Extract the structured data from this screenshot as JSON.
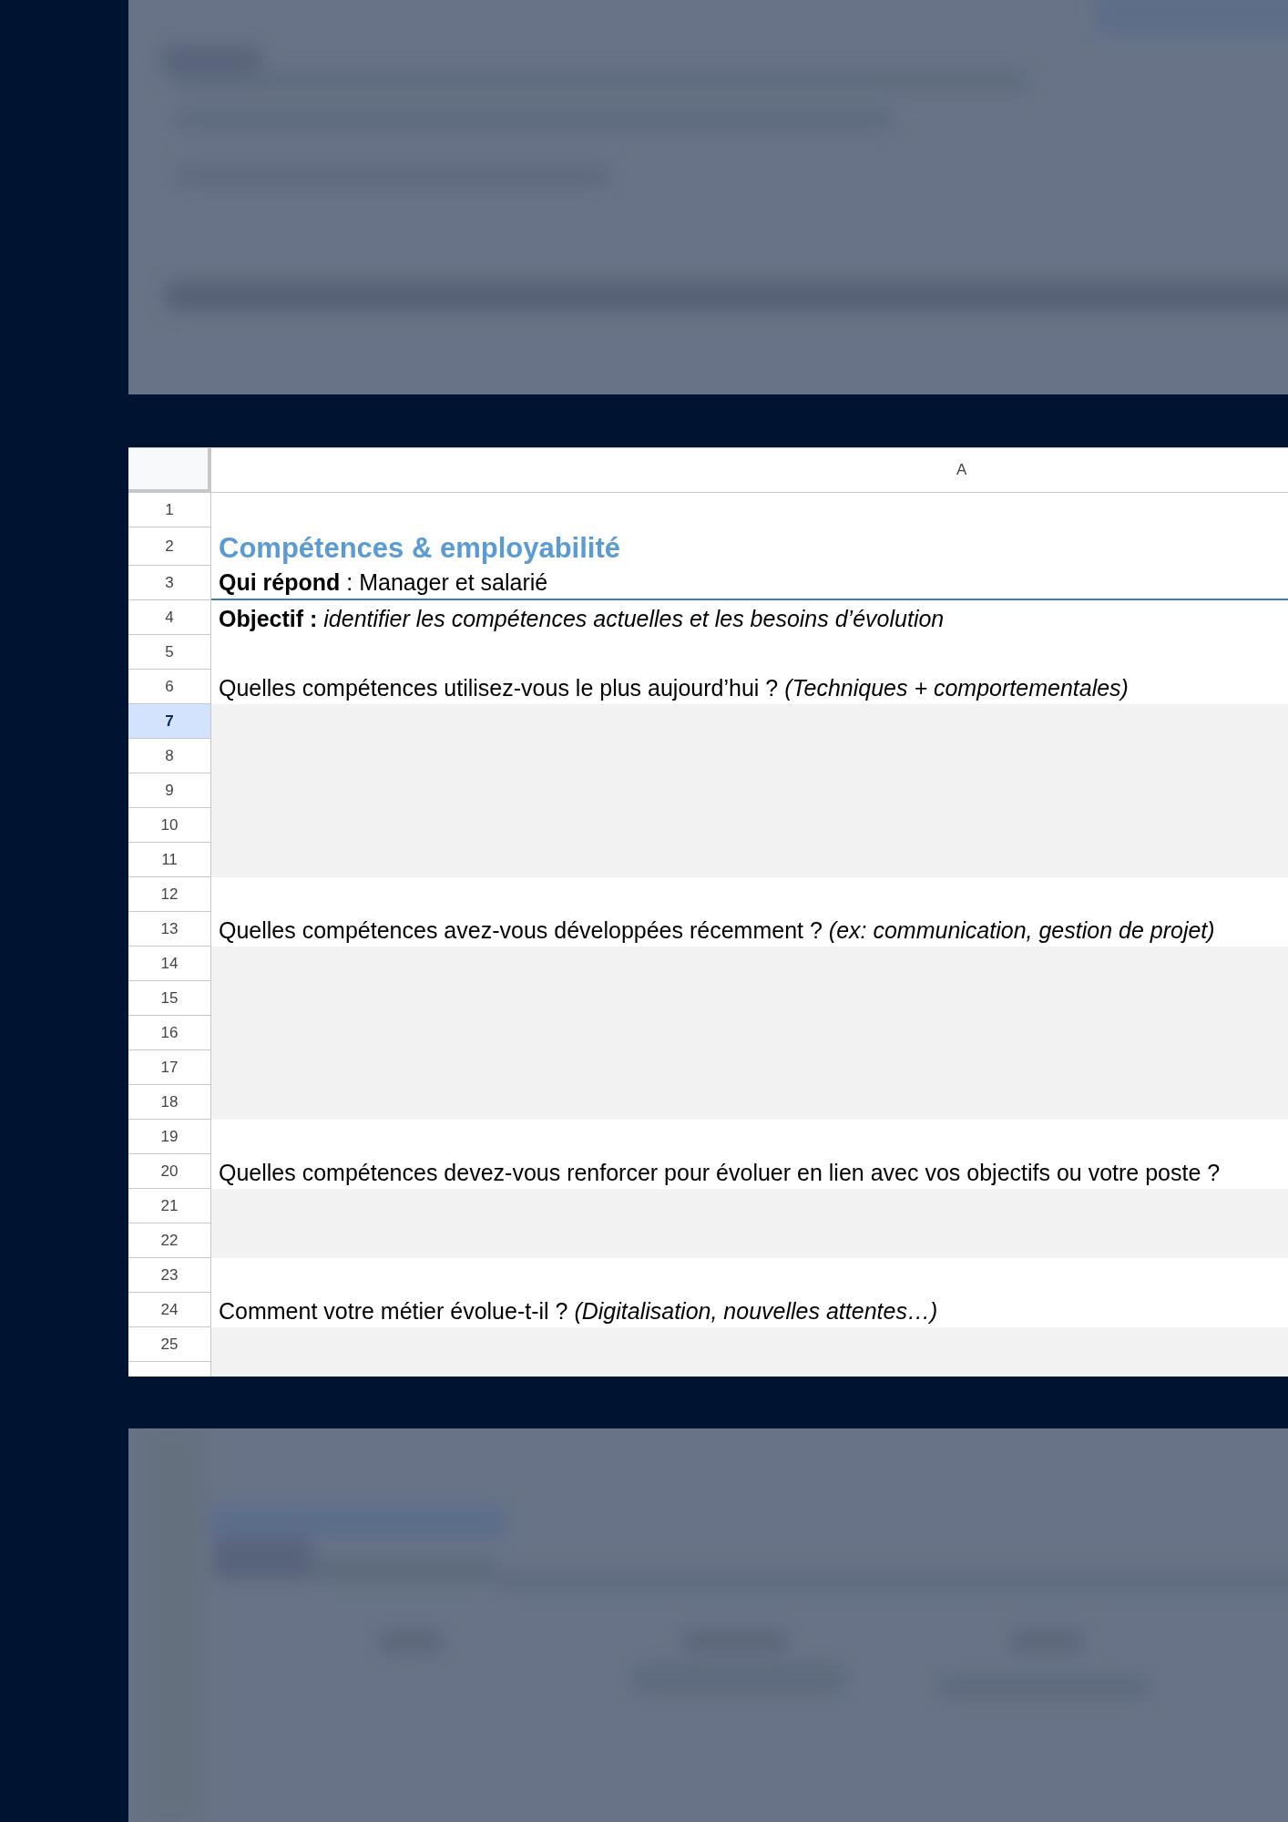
{
  "sheet": {
    "columns": [
      {
        "label": "A"
      }
    ],
    "rows": [
      {
        "number": "1",
        "kind": "blank",
        "selected": false,
        "bottom_border": false
      },
      {
        "number": "2",
        "kind": "title",
        "text": "Compétences & employabilité",
        "selected": false,
        "bottom_border": false
      },
      {
        "number": "3",
        "kind": "info",
        "text": "**Qui répond** : Manager et salarié",
        "selected": false,
        "bottom_border": true
      },
      {
        "number": "4",
        "kind": "info",
        "text": "**Objectif :** *identifier les compétences actuelles et les besoins d’évolution*",
        "selected": false,
        "bottom_border": false
      },
      {
        "number": "5",
        "kind": "blank",
        "selected": false,
        "bottom_border": false
      },
      {
        "number": "6",
        "kind": "question",
        "text": "Quelles compétences utilisez-vous le plus aujourd’hui ? *(Techniques + comportementales)*",
        "selected": false,
        "bottom_border": false
      },
      {
        "number": "7",
        "kind": "answer",
        "selected": true,
        "bottom_border": false
      },
      {
        "number": "8",
        "kind": "answer",
        "selected": false,
        "bottom_border": false
      },
      {
        "number": "9",
        "kind": "answer",
        "selected": false,
        "bottom_border": false
      },
      {
        "number": "10",
        "kind": "answer",
        "selected": false,
        "bottom_border": false
      },
      {
        "number": "11",
        "kind": "answer",
        "selected": false,
        "bottom_border": false
      },
      {
        "number": "12",
        "kind": "blank",
        "selected": false,
        "bottom_border": false
      },
      {
        "number": "13",
        "kind": "question",
        "text": "Quelles compétences avez-vous développées récemment ? *(ex: communication, gestion de projet)*",
        "selected": false,
        "bottom_border": false
      },
      {
        "number": "14",
        "kind": "answer",
        "selected": false,
        "bottom_border": false
      },
      {
        "number": "15",
        "kind": "answer",
        "selected": false,
        "bottom_border": false
      },
      {
        "number": "16",
        "kind": "answer",
        "selected": false,
        "bottom_border": false
      },
      {
        "number": "17",
        "kind": "answer",
        "selected": false,
        "bottom_border": false
      },
      {
        "number": "18",
        "kind": "answer",
        "selected": false,
        "bottom_border": false
      },
      {
        "number": "19",
        "kind": "blank",
        "selected": false,
        "bottom_border": false
      },
      {
        "number": "20",
        "kind": "question",
        "text": "Quelles compétences devez-vous renforcer pour évoluer en lien avec vos objectifs ou votre poste ?",
        "selected": false,
        "bottom_border": false
      },
      {
        "number": "21",
        "kind": "answer",
        "selected": false,
        "bottom_border": false
      },
      {
        "number": "22",
        "kind": "answer",
        "selected": false,
        "bottom_border": false
      },
      {
        "number": "23",
        "kind": "blank",
        "selected": false,
        "bottom_border": false
      },
      {
        "number": "24",
        "kind": "question",
        "text": "Comment votre métier évolue-t-il ? *(Digitalisation, nouvelles attentes…)*",
        "selected": false,
        "bottom_border": false
      },
      {
        "number": "25",
        "kind": "answer",
        "selected": false,
        "bottom_border": false
      },
      {
        "kind": "answer",
        "selected": false
      }
    ]
  }
}
